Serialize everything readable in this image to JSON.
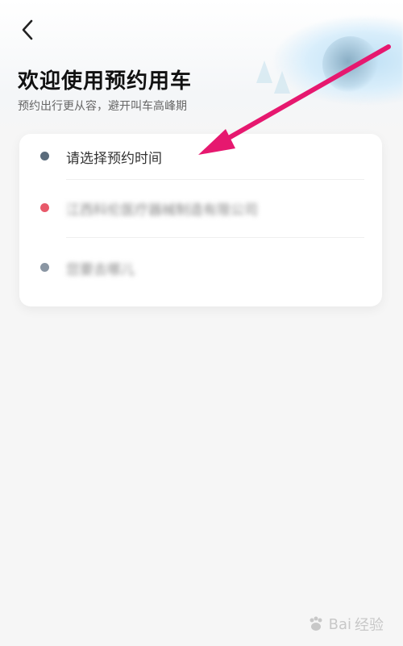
{
  "header": {
    "title": "欢迎使用预约用车",
    "subtitle": "预约出行更从容，避开叫车高峰期"
  },
  "card": {
    "rows": [
      {
        "label": "请选择预约时间",
        "icon": "clock-icon",
        "dot_color": "#5a6b7b"
      },
      {
        "label": "江西科伦医疗器械制造有限公司",
        "icon": "pickup-location-icon",
        "dot_color": "#e8596a"
      },
      {
        "label": "您要去哪儿",
        "icon": "destination-icon",
        "dot_color": "#8a96a3"
      }
    ]
  },
  "annotation": {
    "arrow_color": "#e6186f"
  },
  "watermark": {
    "brand_text": "Bai",
    "sub_text": "经验"
  }
}
